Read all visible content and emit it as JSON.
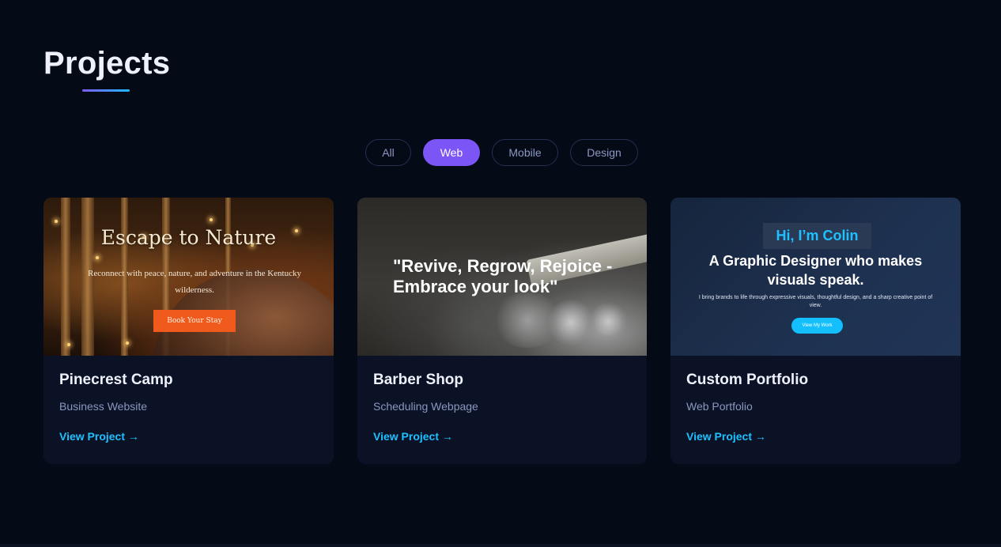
{
  "section": {
    "title": "Projects",
    "accent_gradient": [
      "#7c5cf2",
      "#1fb8ff"
    ]
  },
  "filters": [
    {
      "label": "All",
      "active": false
    },
    {
      "label": "Web",
      "active": true
    },
    {
      "label": "Mobile",
      "active": false
    },
    {
      "label": "Design",
      "active": false
    }
  ],
  "projects": [
    {
      "title": "Pinecrest Camp",
      "category": "Business Website",
      "link_label": "View Project →",
      "preview": {
        "headline": "Escape to Nature",
        "text": "Reconnect with peace, nature, and adventure in the Kentucky wilderness.",
        "button": "Book Your Stay"
      }
    },
    {
      "title": "Barber Shop",
      "category": "Scheduling Webpage",
      "link_label": "View Project →",
      "preview": {
        "headline": "\"Revive, Regrow, Rejoice - Embrace your look\""
      }
    },
    {
      "title": "Custom Portfolio",
      "category": "Web Portfolio",
      "link_label": "View Project →",
      "preview": {
        "greeting": "Hi, I’m Colin",
        "headline": "A Graphic Designer who makes visuals speak.",
        "text": "I bring brands to life through expressive visuals, thoughtful design, and a sharp creative point of view.",
        "button": "View My Work"
      }
    }
  ],
  "colors": {
    "background": "#050a17",
    "card": "#0b1226",
    "active_filter": "#7b55f5",
    "link": "#1ec0ff"
  }
}
